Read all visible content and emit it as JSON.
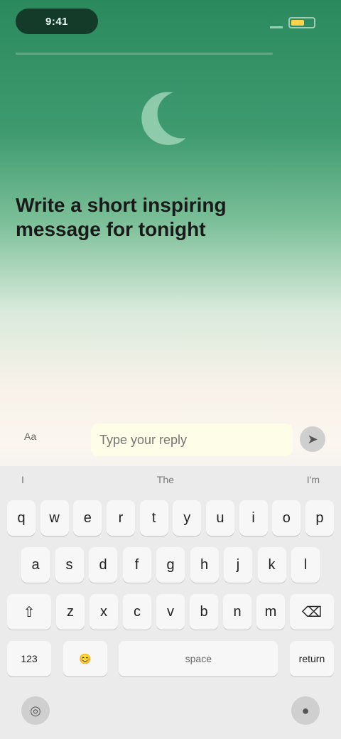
{
  "status_bar": {
    "time": "9:41"
  },
  "prompt": {
    "question": "Write a short inspiring message for tonight"
  },
  "input": {
    "label": "Aa",
    "placeholder": "Type your reply"
  },
  "keyboard": {
    "suggestions": [
      "I",
      "The",
      "I'm"
    ],
    "row1": [
      "q",
      "w",
      "e",
      "r",
      "t",
      "y",
      "u",
      "i",
      "o",
      "p"
    ],
    "row2": [
      "a",
      "s",
      "d",
      "f",
      "g",
      "h",
      "j",
      "k",
      "l"
    ],
    "row3": [
      "⇧",
      "z",
      "x",
      "c",
      "v",
      "b",
      "n",
      "m",
      "⌫"
    ],
    "row4": [
      "123",
      "😊",
      "space",
      "return"
    ],
    "space_label": "space"
  },
  "colors": {
    "accent_green": "#2a8a5e"
  }
}
